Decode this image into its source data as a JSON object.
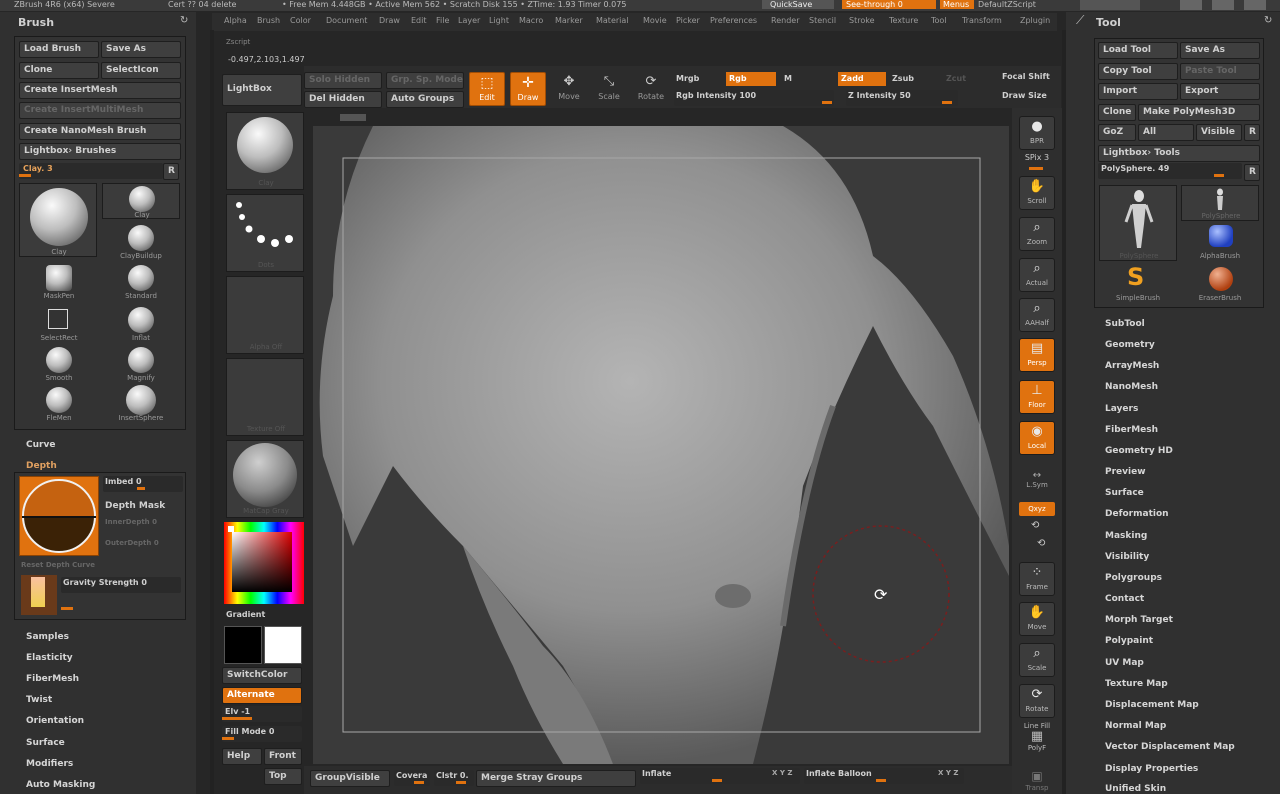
{
  "topstrip": {
    "left_text": "ZBrush 4R6 (x64) Severe",
    "center_text": "Cert ?? 04 delete",
    "status_text": "• Free Mem 4.448GB • Active Mem 562 • Scratch Disk 155 • ZTime: 1.93 Timer 0.075",
    "quicksave": "QuickSave",
    "seethrough": "See-through 0",
    "menus": "Menus",
    "script": "DefaultZScript"
  },
  "menubar": [
    "Alpha",
    "Brush",
    "Color",
    "Document",
    "Draw",
    "Edit",
    "File",
    "Layer",
    "Light",
    "Macro",
    "Marker",
    "Material",
    "Movie",
    "Picker",
    "Preferences",
    "Render",
    "Stencil",
    "Stroke",
    "Texture",
    "Tool",
    "Transform",
    "Zplugin"
  ],
  "coords": {
    "label": "Zscript",
    "value": "-0.497,2.103,1.497"
  },
  "brush_panel": {
    "title": "Brush",
    "load_brush": "Load Brush",
    "save_as": "Save As",
    "clone": "Clone",
    "select_icon": "SelectIcon",
    "create_insertmesh": "Create InsertMesh",
    "create_insertmulti": "Create InsertMultiMesh",
    "create_nanomesh": "Create NanoMesh Brush",
    "lightbox_brushes": "Lightbox› Brushes",
    "current": "Clay. 3",
    "r": "R",
    "brushes": [
      {
        "name": "Clay"
      },
      {
        "name": "Clay"
      },
      {
        "name": "ClayBuildup"
      },
      {
        "name": "MaskPen"
      },
      {
        "name": "Standard"
      },
      {
        "name": "SelectRect"
      },
      {
        "name": "Inflat"
      },
      {
        "name": "Smooth"
      },
      {
        "name": "Magnify"
      },
      {
        "name": "FleMen"
      },
      {
        "name": "InsertSphere"
      }
    ],
    "sections_top": [
      "Curve",
      "Depth"
    ],
    "imbed": "Imbed 0",
    "depth_mask": "Depth Mask",
    "inner_depth": "InnerDepth 0",
    "outer_depth": "OuterDepth 0",
    "reset_depth": "Reset Depth Curve",
    "gravity": "Gravity Strength 0",
    "sections_bottom": [
      "Samples",
      "Elasticity",
      "FiberMesh",
      "Twist",
      "Orientation",
      "Surface",
      "Modifiers",
      "Auto Masking"
    ]
  },
  "shelf": {
    "lightbox": "LightBox",
    "thumbs": [
      "Clay",
      "Dots",
      "Alpha Off",
      "Texture Off",
      "MatCap Gray"
    ],
    "gradient": "Gradient",
    "switch_color": "SwitchColor",
    "alternate": "Alternate",
    "elv": "Elv -1",
    "fill_mode": "Fill Mode 0",
    "help": "Help",
    "front": "Front",
    "top": "Top",
    "group_visible": "GroupVisible"
  },
  "top_toolbar": {
    "solo": "Solo Hidden",
    "del_hidden": "Del Hidden",
    "auto_groups": "Auto Groups",
    "grp_front": "Grp. Sp. Mode",
    "edit": "Edit",
    "draw": "Draw",
    "move": "Move",
    "scale": "Scale",
    "rotate": "Rotate",
    "mrgb": "Mrgb",
    "rgb": "Rgb",
    "m": "M",
    "zadd": "Zadd",
    "zsub": "Zsub",
    "zcut": "Zcut",
    "rgb_intensity": "Rgb Intensity 100",
    "z_intensity": "Z Intensity 50",
    "focal_shift": "Focal Shift",
    "draw_size": "Draw Size"
  },
  "right_strip": [
    {
      "label": "BPR",
      "icon": "render-icon"
    },
    {
      "label": "SPix 3",
      "icon": "spix-icon"
    },
    {
      "label": "Scroll",
      "icon": "scroll-icon"
    },
    {
      "label": "Zoom",
      "icon": "zoom-icon"
    },
    {
      "label": "Actual",
      "icon": "actual-icon"
    },
    {
      "label": "AAHalf",
      "icon": "aahalf-icon"
    },
    {
      "label": "Persp",
      "icon": "persp-icon"
    },
    {
      "label": "Floor",
      "icon": "floor-icon"
    },
    {
      "label": "Local",
      "icon": "local-icon"
    },
    {
      "label": "L.Sym",
      "icon": "lsym-icon"
    },
    {
      "label": "Qxyz",
      "icon": "xyz-icon"
    },
    {
      "label": "Frame",
      "icon": "frame-icon"
    },
    {
      "label": "Move",
      "icon": "move-icon"
    },
    {
      "label": "Scale",
      "icon": "scale-icon"
    },
    {
      "label": "Rotate",
      "icon": "rotate-icon"
    },
    {
      "label": "Line Fill",
      "icon": "linefill-icon"
    },
    {
      "label": "PolyF",
      "icon": "polyf-icon"
    },
    {
      "label": "Transp",
      "icon": "transp-icon"
    }
  ],
  "tool_panel": {
    "title": "Tool",
    "load_tool": "Load Tool",
    "save_as": "Save As",
    "copy_tool": "Copy Tool",
    "paste_tool": "Paste Tool",
    "import": "Import",
    "export": "Export",
    "clone": "Clone",
    "make_polymesh": "Make PolyMesh3D",
    "goz": "GoZ",
    "all": "All",
    "visible": "Visible",
    "r": "R",
    "lightbox_tools": "Lightbox› Tools",
    "current": "PolySphere. 49",
    "tools": [
      {
        "name": "PolySphere"
      },
      {
        "name": "PolySphere"
      },
      {
        "name": "AlphaBrush"
      },
      {
        "name": "SimpleBrush"
      },
      {
        "name": "EraserBrush"
      }
    ],
    "sections": [
      "SubTool",
      "Geometry",
      "ArrayMesh",
      "NanoMesh",
      "Layers",
      "FiberMesh",
      "Geometry HD",
      "Preview",
      "Surface",
      "Deformation",
      "Masking",
      "Visibility",
      "Polygroups",
      "Contact",
      "Morph Target",
      "Polypaint",
      "UV Map",
      "Texture Map",
      "Displacement Map",
      "Normal Map",
      "Vector Displacement Map",
      "Display Properties",
      "Unified Skin"
    ]
  },
  "bottom_bar": {
    "covera": "Covera",
    "clstr": "Clstr 0.",
    "merge": "Merge Stray Groups",
    "inflate": "Inflate",
    "inflate_balloon": "Inflate Balloon",
    "xyz1": "X Y Z",
    "xyz2": "X Y Z"
  },
  "colors": {
    "accent": "#e0720f",
    "panel": "#303030",
    "bg": "#262626"
  }
}
